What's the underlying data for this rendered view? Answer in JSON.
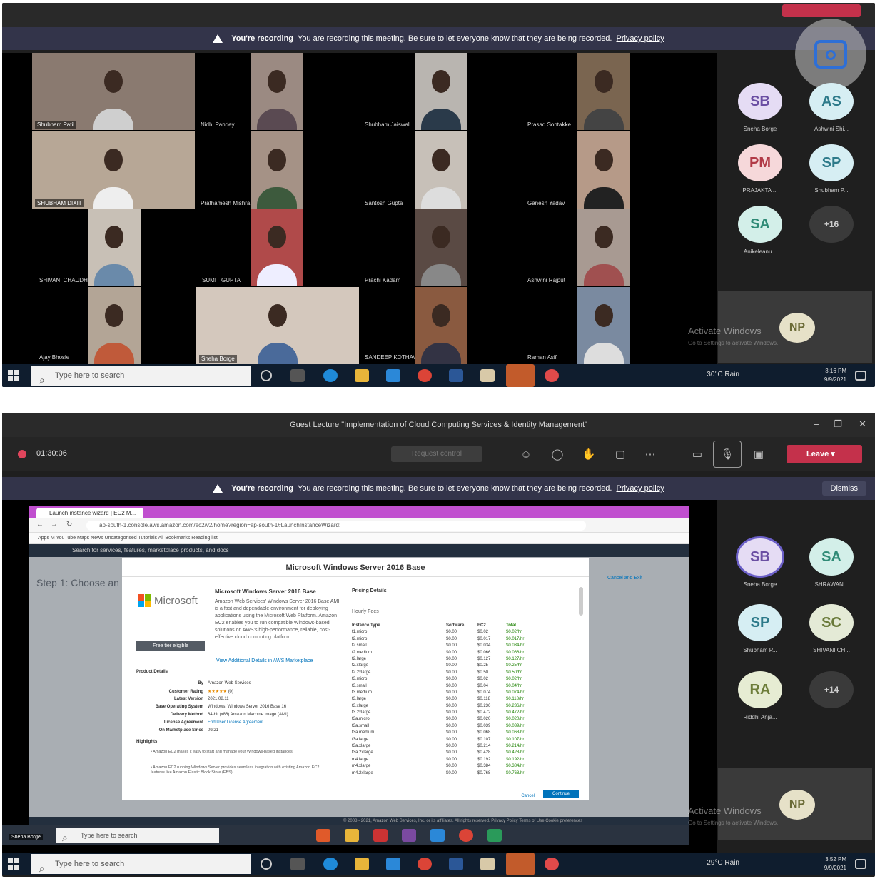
{
  "recording_banner": {
    "title": "You're recording",
    "message": "You are recording this meeting. Be sure to let everyone know that they are being recorded.",
    "link": "Privacy policy",
    "dismiss": "Dismiss"
  },
  "shot1": {
    "tiles": [
      "Shubham Patil",
      "Nidhi Pandey",
      "Shubham Jaiswal",
      "Prasad Sontakke",
      "SHUBHAM DIXIT",
      "Prathamesh Mishra",
      "Santosh Gupta",
      "Ganesh Yadav",
      "SHIVANI CHAUDHARI",
      "SUMIT GUPTA",
      "Prachi Kadam",
      "Ashwini Rajput",
      "Ajay Bhosle",
      "Sneha Borge",
      "SANDEEP KOTHAVADE",
      "Raman Asif"
    ],
    "participants": [
      {
        "initials": "SB",
        "name": "Sneha Borge",
        "bg": "#e5dcf4",
        "fg": "#6b4fa3"
      },
      {
        "initials": "AS",
        "name": "Ashwini Shi...",
        "bg": "#d6eef3",
        "fg": "#2d7a8a"
      },
      {
        "initials": "PM",
        "name": "PRAJAKTA ...",
        "bg": "#f6d8da",
        "fg": "#b13a47"
      },
      {
        "initials": "SP",
        "name": "Shubham P...",
        "bg": "#d6eef3",
        "fg": "#2d7a8a"
      },
      {
        "initials": "SA",
        "name": "Anikeleanu...",
        "bg": "#d3efe9",
        "fg": "#2f8a76"
      }
    ],
    "more": "+16",
    "self_initials": "NP",
    "watermark": "Activate Windows",
    "watermark_sub": "Go to Settings to activate Windows."
  },
  "taskbar": {
    "search_placeholder": "Type here to search",
    "weather": "30°C  Rain",
    "time1": "3:16 PM",
    "date1": "9/9/2021",
    "time2": "3:52 PM",
    "date2": "9/9/2021",
    "weather2": "29°C  Rain"
  },
  "shot2": {
    "window_title": "Guest Lecture \"Implementation of Cloud Computing Services & Identity Management\"",
    "timer": "01:30:06",
    "share_label": "Request control",
    "leave_label": "Leave",
    "participants": [
      {
        "initials": "SB",
        "name": "Sneha Borge",
        "bg": "#e5dcf4",
        "fg": "#6b4fa3"
      },
      {
        "initials": "SA",
        "name": "SHRAWAN...",
        "bg": "#d3efe9",
        "fg": "#2f8a76"
      },
      {
        "initials": "SP",
        "name": "Shubham P...",
        "bg": "#d6eef3",
        "fg": "#2d7a8a"
      },
      {
        "initials": "SC",
        "name": "SHIVANI CH...",
        "bg": "#e4ead6",
        "fg": "#6a7a3a"
      },
      {
        "initials": "RA",
        "name": "Riddhi Anja...",
        "bg": "#e6ecd3",
        "fg": "#6d7d3a"
      }
    ],
    "more": "+14",
    "self_initials": "NP",
    "speaker_tag": "Sneha Borge"
  },
  "browser": {
    "tab": "Launch instance wizard | EC2 M...",
    "url": "ap-south-1.console.aws.amazon.com/ec2/v2/home?region=ap-south-1#LaunchInstanceWizard:",
    "bookmarks": "Apps   M   YouTube   Maps   News   Uncategorised   Tutorials   All Bookmarks   Reading list",
    "aws_search": "Search for services, features, marketplace products, and docs",
    "step": "Step 1: Choose an",
    "cancel_link": "Cancel and Exit",
    "footer": "© 2008 - 2021, Amazon Web Services, Inc. or its affiliates. All rights reserved.    Privacy Policy    Terms of Use    Cookie preferences"
  },
  "modal": {
    "title": "Microsoft Windows Server 2016 Base",
    "logo_text": "Microsoft",
    "product_heading": "Microsoft Windows Server 2016 Base",
    "description": "Amazon Web Services' Windows Server 2016 Base AMI is a fast and dependable environment for deploying applications using the Microsoft Web Platform. Amazon EC2 enables you to run compatible Windows-based solutions on AWS's high-performance, reliable, cost-effective cloud computing platform.",
    "free_button": "Free tier eligible",
    "view_details": "View Additional Details in AWS Marketplace",
    "pricing_heading": "Pricing Details",
    "hourly_fees": "Hourly Fees",
    "product_details_heading": "Product Details",
    "details": [
      {
        "label": "By",
        "value": "Amazon Web Services"
      },
      {
        "label": "Customer Rating",
        "value": "(0)"
      },
      {
        "label": "Latest Version",
        "value": "2021.08.11"
      },
      {
        "label": "Base Operating System",
        "value": "Windows, Windows Server 2016 Base 16"
      },
      {
        "label": "Delivery Method",
        "value": "64-bit (x86) Amazon Machine Image (AMI)"
      },
      {
        "label": "License Agreement",
        "value": "End User License Agreement"
      },
      {
        "label": "On Marketplace Since",
        "value": "09/21"
      }
    ],
    "highlights_heading": "Highlights",
    "highlights": [
      "Amazon EC2 makes it easy to start and manage your Windows-based instances.",
      "Amazon EC2 running Windows Server provides seamless integration with existing Amazon EC2 features like Amazon Elastic Block Store (EBS)."
    ],
    "pricing_headers": [
      "Instance Type",
      "Software",
      "EC2",
      "Total"
    ],
    "pricing_rows": [
      [
        "t1.micro",
        "$0.00",
        "$0.02",
        "$0.02/hr"
      ],
      [
        "t2.micro",
        "$0.00",
        "$0.017",
        "$0.017/hr"
      ],
      [
        "t2.small",
        "$0.00",
        "$0.034",
        "$0.034/hr"
      ],
      [
        "t2.medium",
        "$0.00",
        "$0.066",
        "$0.066/hr"
      ],
      [
        "t2.large",
        "$0.00",
        "$0.127",
        "$0.127/hr"
      ],
      [
        "t2.xlarge",
        "$0.00",
        "$0.25",
        "$0.25/hr"
      ],
      [
        "t2.2xlarge",
        "$0.00",
        "$0.50",
        "$0.50/hr"
      ],
      [
        "t3.micro",
        "$0.00",
        "$0.02",
        "$0.02/hr"
      ],
      [
        "t3.small",
        "$0.00",
        "$0.04",
        "$0.04/hr"
      ],
      [
        "t3.medium",
        "$0.00",
        "$0.074",
        "$0.074/hr"
      ],
      [
        "t3.large",
        "$0.00",
        "$0.118",
        "$0.118/hr"
      ],
      [
        "t3.xlarge",
        "$0.00",
        "$0.236",
        "$0.236/hr"
      ],
      [
        "t3.2xlarge",
        "$0.00",
        "$0.472",
        "$0.472/hr"
      ],
      [
        "t3a.micro",
        "$0.00",
        "$0.020",
        "$0.020/hr"
      ],
      [
        "t3a.small",
        "$0.00",
        "$0.039",
        "$0.039/hr"
      ],
      [
        "t3a.medium",
        "$0.00",
        "$0.068",
        "$0.068/hr"
      ],
      [
        "t3a.large",
        "$0.00",
        "$0.107",
        "$0.107/hr"
      ],
      [
        "t3a.xlarge",
        "$0.00",
        "$0.214",
        "$0.214/hr"
      ],
      [
        "t3a.2xlarge",
        "$0.00",
        "$0.428",
        "$0.428/hr"
      ],
      [
        "m4.large",
        "$0.00",
        "$0.192",
        "$0.192/hr"
      ],
      [
        "m4.xlarge",
        "$0.00",
        "$0.384",
        "$0.384/hr"
      ],
      [
        "m4.2xlarge",
        "$0.00",
        "$0.768",
        "$0.768/hr"
      ]
    ],
    "cancel": "Cancel",
    "continue": "Continue"
  }
}
